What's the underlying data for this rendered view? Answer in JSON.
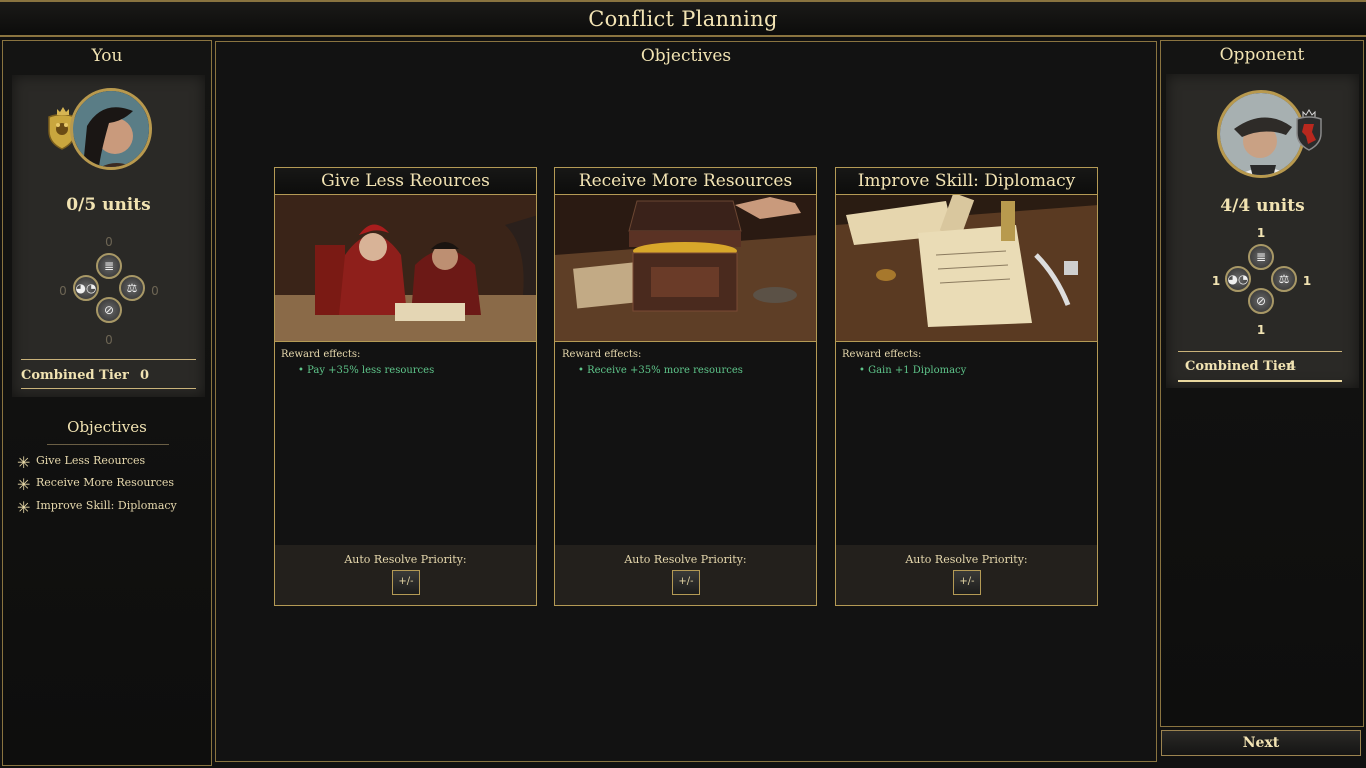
{
  "header": {
    "title": "Conflict Planning"
  },
  "you": {
    "heading": "You",
    "units": "0/5  units",
    "skills": {
      "top": "0",
      "left": "0",
      "right": "0",
      "bottom": "0"
    },
    "combined_tier_label": "Combined Tier",
    "combined_tier_value": "0"
  },
  "objectives_list": {
    "heading": "Objectives",
    "items": [
      "Give Less Reources",
      "Receive More Resources",
      "Improve Skill: Diplomacy"
    ]
  },
  "main": {
    "heading": "Objectives",
    "cards": [
      {
        "title": "Give Less Reources",
        "reward_label": "Reward effects:",
        "reward": "• Pay +35% less resources",
        "priority_label": "Auto Resolve Priority:",
        "priority_button": "+/-"
      },
      {
        "title": "Receive More Resources",
        "reward_label": "Reward effects:",
        "reward": "• Receive +35% more resources",
        "priority_label": "Auto Resolve Priority:",
        "priority_button": "+/-"
      },
      {
        "title": "Improve Skill: Diplomacy",
        "reward_label": "Reward effects:",
        "reward": "• Gain +1 Diplomacy",
        "priority_label": "Auto Resolve Priority:",
        "priority_button": "+/-"
      }
    ]
  },
  "opponent": {
    "heading": "Opponent",
    "units": "4/4  units",
    "skills": {
      "top": "1",
      "left": "1",
      "right": "1",
      "bottom": "1"
    },
    "combined_tier_label": "Combined Tier",
    "combined_tier_value": "4"
  },
  "footer": {
    "next_label": "Next"
  },
  "icons": {
    "crown": "crown-icon",
    "you_emblem": "gold-shield-icon",
    "opponent_emblem": "red-lion-shield-icon",
    "skill_top": "document-icon",
    "skill_left": "mask-icon",
    "skill_right": "scales-icon",
    "skill_bottom": "sword-shield-icon",
    "list_marker": "compass-star-icon"
  },
  "colors": {
    "gold": "#b49a55",
    "reward_green": "#5ec58a",
    "text": "#e8d9a8"
  }
}
